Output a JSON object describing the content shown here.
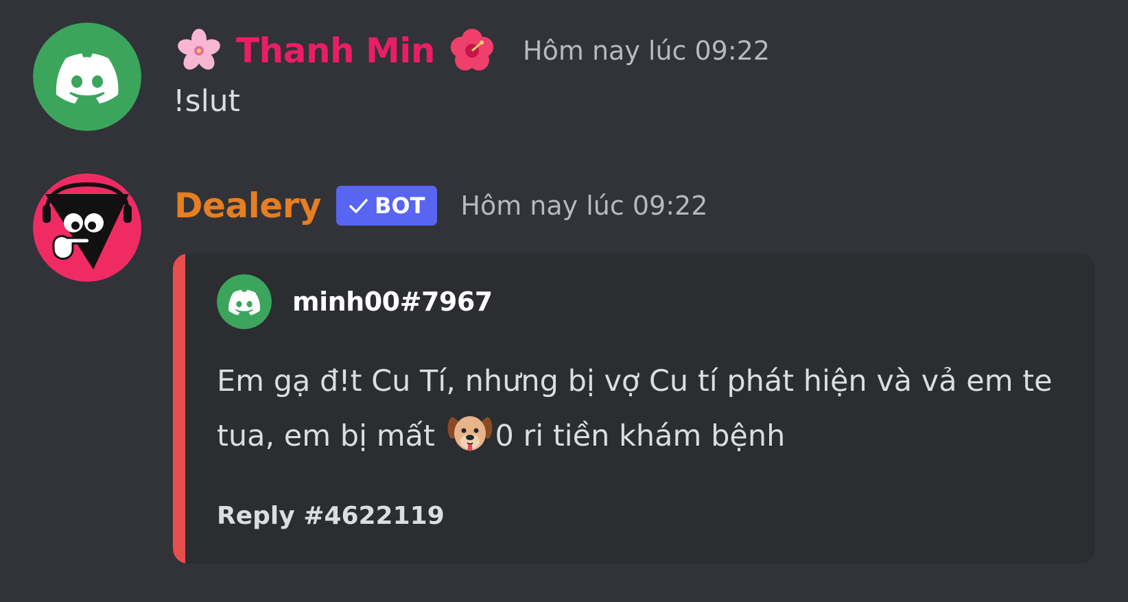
{
  "messages": [
    {
      "author": "Thanh Min",
      "prefix_emoji": "cherry-blossom-icon",
      "suffix_emoji": "hibiscus-icon",
      "timestamp": "Hôm nay lúc 09:22",
      "content": "!slut",
      "name_color": "#e91e63",
      "avatar": "discord-default-avatar-green"
    },
    {
      "author": "Dealery",
      "bot_tag": "BOT",
      "timestamp": "Hôm nay lúc 09:22",
      "name_color": "#e67e22",
      "avatar": "dealery-bot-avatar",
      "embed": {
        "accent_color": "#e84e4e",
        "author_name": "minh00#7967",
        "author_icon": "discord-default-avatar-green",
        "description_part1": "Em gạ đ!t Cu Tí, nhưng bị vợ Cu tí phát hiện và vả em te tua, em bị mất ",
        "description_emoji": "dog-face-icon",
        "description_part2": "0 ri tiền khám bệnh",
        "footer": "Reply #4622119"
      }
    }
  ],
  "colors": {
    "background": "#313338",
    "embed_background": "#2b2d31",
    "bot_tag": "#5865f2",
    "timestamp": "#b5bac1",
    "text": "#dbdee1",
    "discord_green": "#3ba55c"
  }
}
